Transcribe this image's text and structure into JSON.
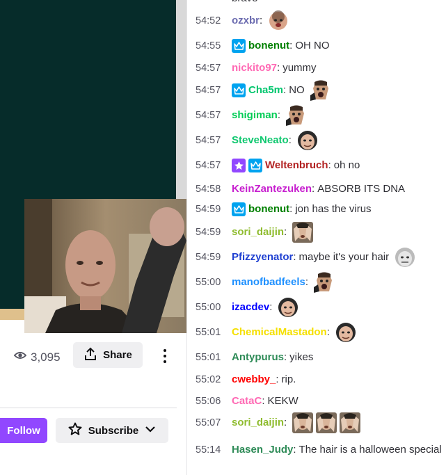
{
  "chat": {
    "top_fragment": "brave",
    "messages": [
      {
        "time": "54:52",
        "user": "ozxbr",
        "color": "#6c6cb0",
        "text": "",
        "badges": [],
        "emotes": [
          "face-emote"
        ]
      },
      {
        "time": "54:55",
        "user": "bonenut",
        "color": "#008000",
        "text": "OH NO",
        "badges": [
          "crown-badge"
        ],
        "emotes": []
      },
      {
        "time": "54:57",
        "user": "nickito97",
        "color": "#ff69b4",
        "text": "yummy",
        "badges": [],
        "emotes": []
      },
      {
        "time": "54:57",
        "user": "Cha5m",
        "color": "#00c66e",
        "text": "NO",
        "badges": [
          "crown-badge"
        ],
        "emotes": [
          "pog-emote"
        ]
      },
      {
        "time": "54:57",
        "user": "shigiman",
        "color": "#00cc55",
        "text": "",
        "badges": [],
        "emotes": [
          "pog-emote"
        ]
      },
      {
        "time": "54:57",
        "user": "SteveNeato",
        "color": "#10c870",
        "text": "",
        "badges": [],
        "emotes": [
          "bald-face-emote"
        ]
      },
      {
        "time": "54:57",
        "user": "Weltenbruch",
        "color": "#b22222",
        "text": "oh no",
        "badges": [
          "star-badge",
          "crown-badge"
        ],
        "emotes": []
      },
      {
        "time": "54:58",
        "user": "KeinZantezuken",
        "color": "#c71fcf",
        "text": "ABSORB ITS DNA",
        "badges": [],
        "emotes": []
      },
      {
        "time": "54:59",
        "user": "bonenut",
        "color": "#008000",
        "text": "jon has the virus",
        "badges": [
          "crown-badge"
        ],
        "emotes": []
      },
      {
        "time": "54:59",
        "user": "sori_daijin",
        "color": "#8fbc2f",
        "text": "",
        "badges": [],
        "emotes": [
          "hands-emote"
        ]
      },
      {
        "time": "54:59",
        "user": "Pfizzyenator",
        "color": "#1e3fd1",
        "text": "maybe it's your hair",
        "badges": [],
        "emotes": [
          "grey-face-emote"
        ]
      },
      {
        "time": "55:00",
        "user": "manofbadfeels",
        "color": "#1e90ff",
        "text": "",
        "badges": [],
        "emotes": [
          "pog-emote"
        ]
      },
      {
        "time": "55:00",
        "user": "izacdev",
        "color": "#0000ff",
        "text": "",
        "badges": [],
        "emotes": [
          "bald-face-emote"
        ]
      },
      {
        "time": "55:01",
        "user": "ChemicalMastadon",
        "color": "#f5e000",
        "text": "",
        "badges": [],
        "emotes": [
          "bald-face-emote"
        ]
      },
      {
        "time": "55:01",
        "user": "Antypurus",
        "color": "#2e8b57",
        "text": "yikes",
        "badges": [],
        "emotes": []
      },
      {
        "time": "55:02",
        "user": "cwebby_",
        "color": "#ff0000",
        "text": "rip.",
        "badges": [],
        "emotes": []
      },
      {
        "time": "55:06",
        "user": "CataC",
        "color": "#ff69b4",
        "text": "KEKW",
        "badges": [],
        "emotes": []
      },
      {
        "time": "55:07",
        "user": "sori_daijin",
        "color": "#8fbc2f",
        "text": "",
        "badges": [],
        "emotes": [
          "hands-emote",
          "hands-emote",
          "hands-emote"
        ]
      },
      {
        "time": "55:14",
        "user": "Hasen_Judy",
        "color": "#2e8b57",
        "text": "The hair is a halloween special",
        "badges": [],
        "emotes": []
      }
    ]
  },
  "stream": {
    "viewer_count": "3,095",
    "share_label": "Share",
    "follow_label": "Follow",
    "subscribe_label": "Subscribe"
  },
  "colors": {
    "video_bg": "#062c2a",
    "follow": "#9147ff",
    "crown_badge": "#00a3ef",
    "star_badge": "#9147ff",
    "button_bg": "#efeff1"
  }
}
